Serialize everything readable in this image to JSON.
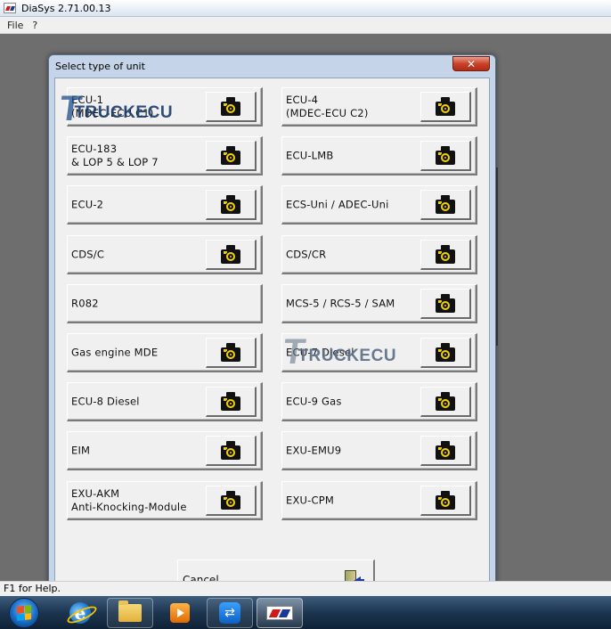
{
  "app": {
    "title": "DiaSys 2.71.00.13"
  },
  "menu": {
    "items": [
      "File",
      "?"
    ]
  },
  "status": {
    "text": "F1 for Help."
  },
  "dialog": {
    "title": "Select type of unit",
    "close_glyph": "✕",
    "units": [
      {
        "label": "ECU-1\n(MDEC-ECU C1)",
        "has_camera": true
      },
      {
        "label": "ECU-4\n(MDEC-ECU C2)",
        "has_camera": true
      },
      {
        "label": "ECU-183\n& LOP 5 & LOP 7",
        "has_camera": true
      },
      {
        "label": "ECU-LMB",
        "has_camera": true
      },
      {
        "label": "ECU-2",
        "has_camera": true
      },
      {
        "label": "ECS-Uni / ADEC-Uni",
        "has_camera": true
      },
      {
        "label": "CDS/C",
        "has_camera": true
      },
      {
        "label": "CDS/CR",
        "has_camera": true
      },
      {
        "label": "R082",
        "has_camera": false
      },
      {
        "label": "MCS-5 / RCS-5 / SAM",
        "has_camera": true
      },
      {
        "label": "Gas engine MDE",
        "has_camera": true
      },
      {
        "label": "ECU-7 Diesel",
        "has_camera": true
      },
      {
        "label": "ECU-8 Diesel",
        "has_camera": true
      },
      {
        "label": "ECU-9 Gas",
        "has_camera": true
      },
      {
        "label": "EIM",
        "has_camera": true
      },
      {
        "label": "EXU-EMU9",
        "has_camera": true
      },
      {
        "label": "EXU-AKM\nAnti-Knocking-Module",
        "has_camera": true
      },
      {
        "label": "EXU-CPM",
        "has_camera": true
      }
    ],
    "cancel_label": "Cancel"
  },
  "watermark": {
    "text": "TRUCKECU",
    "letter": "T"
  },
  "taskbar": {
    "items": [
      {
        "name": "start-button",
        "icon": "windows-start-orb"
      },
      {
        "name": "internet-explorer",
        "icon": "ie-icon"
      },
      {
        "name": "file-explorer",
        "icon": "folder-icon"
      },
      {
        "name": "media-player",
        "icon": "media-icon"
      },
      {
        "name": "teamviewer",
        "icon": "teamviewer-icon"
      },
      {
        "name": "diasys",
        "icon": "mtu-logo-icon"
      }
    ],
    "teamviewer_glyph": "⇄"
  }
}
